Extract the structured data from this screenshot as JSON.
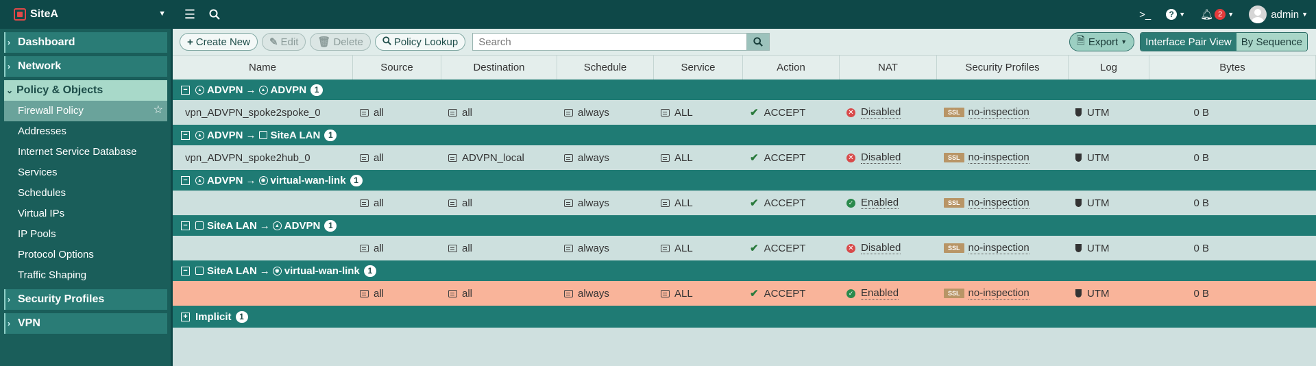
{
  "topbar": {
    "device_name": "SiteA",
    "user": "admin",
    "notifications": "2"
  },
  "sidebar": {
    "sections": [
      "Dashboard",
      "Network",
      "Policy & Objects",
      "Security Profiles",
      "VPN"
    ],
    "policy_items": [
      "Firewall Policy",
      "Addresses",
      "Internet Service Database",
      "Services",
      "Schedules",
      "Virtual IPs",
      "IP Pools",
      "Protocol Options",
      "Traffic Shaping"
    ]
  },
  "toolbar": {
    "create_new": "Create New",
    "edit": "Edit",
    "delete": "Delete",
    "policy_lookup": "Policy Lookup",
    "search_placeholder": "Search",
    "export": "Export",
    "view_pair": "Interface Pair View",
    "view_seq": "By Sequence"
  },
  "columns": [
    "Name",
    "Source",
    "Destination",
    "Schedule",
    "Service",
    "Action",
    "NAT",
    "Security Profiles",
    "Log",
    "Bytes"
  ],
  "groups": [
    {
      "from": "ADVPN",
      "to": "ADVPN",
      "count": "1",
      "row": {
        "name": "vpn_ADVPN_spoke2spoke_0",
        "source": "all",
        "destination": "all",
        "schedule": "always",
        "service": "ALL",
        "action": "ACCEPT",
        "nat": "Disabled",
        "ssl": "SSL",
        "profile": "no-inspection",
        "log": "UTM",
        "bytes": "0 B"
      }
    },
    {
      "from": "ADVPN",
      "to": "SiteA LAN",
      "count": "1",
      "row": {
        "name": "vpn_ADVPN_spoke2hub_0",
        "source": "all",
        "destination": "ADVPN_local",
        "schedule": "always",
        "service": "ALL",
        "action": "ACCEPT",
        "nat": "Disabled",
        "ssl": "SSL",
        "profile": "no-inspection",
        "log": "UTM",
        "bytes": "0 B"
      }
    },
    {
      "from": "ADVPN",
      "to": "virtual-wan-link",
      "count": "1",
      "row": {
        "name": "",
        "source": "all",
        "destination": "all",
        "schedule": "always",
        "service": "ALL",
        "action": "ACCEPT",
        "nat": "Enabled",
        "ssl": "SSL",
        "profile": "no-inspection",
        "log": "UTM",
        "bytes": "0 B"
      }
    },
    {
      "from": "SiteA LAN",
      "to": "ADVPN",
      "count": "1",
      "row": {
        "name": "",
        "source": "all",
        "destination": "all",
        "schedule": "always",
        "service": "ALL",
        "action": "ACCEPT",
        "nat": "Disabled",
        "ssl": "SSL",
        "profile": "no-inspection",
        "log": "UTM",
        "bytes": "0 B"
      }
    },
    {
      "from": "SiteA LAN",
      "to": "virtual-wan-link",
      "count": "1",
      "row": {
        "name": "",
        "source": "all",
        "destination": "all",
        "schedule": "always",
        "service": "ALL",
        "action": "ACCEPT",
        "nat": "Enabled",
        "ssl": "SSL",
        "profile": "no-inspection",
        "log": "UTM",
        "bytes": "0 B"
      }
    }
  ],
  "implicit": {
    "label": "Implicit",
    "count": "1"
  }
}
